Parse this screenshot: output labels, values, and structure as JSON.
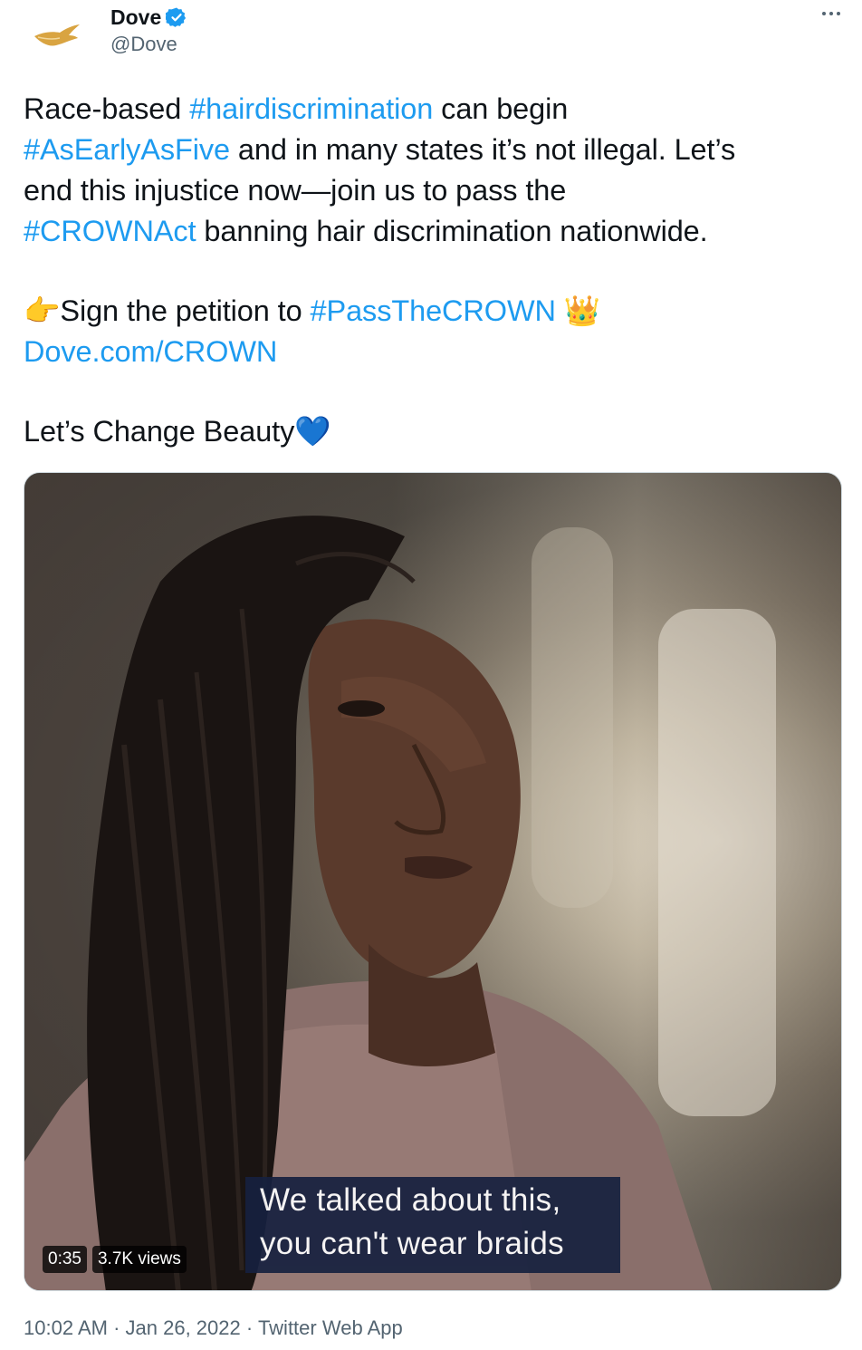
{
  "author": {
    "display_name": "Dove",
    "handle": "@Dove",
    "verified_icon": "verified-badge-icon",
    "avatar_icon": "dove-bird-logo"
  },
  "more_menu_icon": "more-options-icon",
  "tweet": {
    "lines": [
      [
        "Race-based ",
        "#hairdiscrimination",
        " can begin"
      ],
      [
        "#AsEarlyAsFive",
        " and in many states it’s not illegal. Let’s"
      ],
      [
        "end this injustice now—join us to pass the"
      ],
      [
        "#CROWNAct",
        " banning hair discrimination nationwide."
      ],
      [
        "👉Sign the petition to ",
        "#PassTheCROWN",
        " 👑"
      ],
      [
        "Dove.com/CROWN"
      ],
      [
        "Let’s Change Beauty💙"
      ]
    ],
    "hashtags": [
      "#hairdiscrimination",
      "#AsEarlyAsFive",
      "#CROWNAct",
      "#PassTheCROWN"
    ],
    "link": "Dove.com/CROWN"
  },
  "media": {
    "type": "video",
    "subtitle_line1": "We talked about this,",
    "subtitle_line2": "you can't wear braids",
    "duration": "0:35",
    "views": "3.7K views"
  },
  "meta": {
    "time": "10:02 AM",
    "separator": "·",
    "date": "Jan 26, 2022",
    "source": "Twitter Web App"
  },
  "colors": {
    "link": "#1d9bf0",
    "text": "#0f1419",
    "secondary": "#536471",
    "logo_gold": "#d9a441"
  }
}
